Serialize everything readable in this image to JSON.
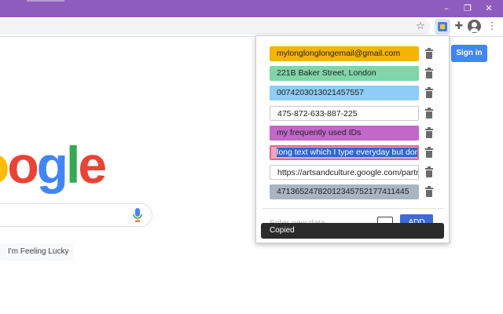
{
  "browser": {
    "window_controls": {
      "minimize": "–",
      "maximize": "❐",
      "close": "✕"
    },
    "toolbar": {
      "star": "☆",
      "puzzle": "✚",
      "menu": "⋮"
    }
  },
  "google_page": {
    "logo_letters": [
      {
        "char": "o",
        "color": "#ea4335"
      },
      {
        "char": "g",
        "color": "#4285f4"
      },
      {
        "char": "l",
        "color": "#34a853"
      },
      {
        "char": "e",
        "color": "#ea4335"
      }
    ],
    "logo_partial_first": {
      "char": "o",
      "color": "#fbbc05"
    },
    "lucky_button": "I'm Feeling Lucky",
    "sign_in": "Sign in"
  },
  "popup": {
    "items": [
      {
        "text": "mylonglonglongemail@gmail.com",
        "bg": "#f5b400"
      },
      {
        "text": "221B Baker Street, London",
        "bg": "#7fd6a8"
      },
      {
        "text": "0074203013021457557",
        "bg": "#8ecdf5"
      },
      {
        "text": "475-872-633-887-225",
        "bg": "#ffffff"
      },
      {
        "text": "my frequently used IDs",
        "bg": "#c168c9"
      },
      {
        "text": "long text which I type everyday but don't want to",
        "bg": "#f4a4bc",
        "selected": true
      },
      {
        "text": "https://artsandculture.google.com/partner",
        "bg": "#ffffff"
      },
      {
        "text": "47136524782012345752177411445",
        "bg": "#a9b6c2"
      }
    ],
    "new_data_placeholder": "Enter new data",
    "add_button": "ADD",
    "toast": "Copied"
  }
}
